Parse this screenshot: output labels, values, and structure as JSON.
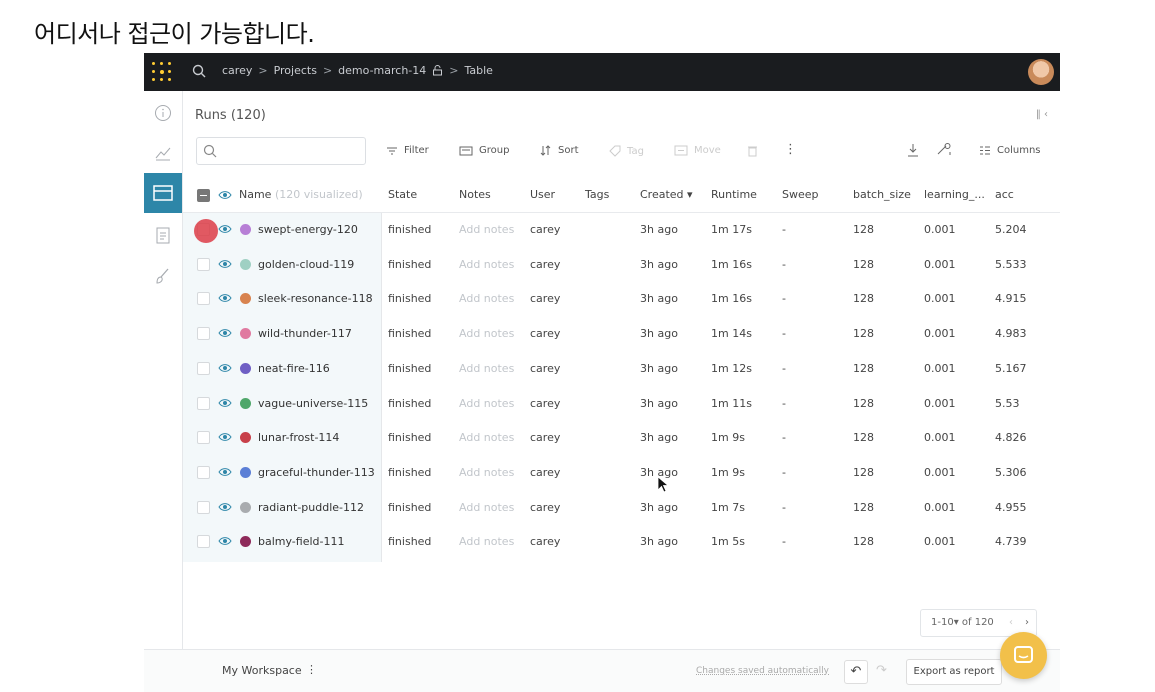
{
  "caption": "어디서나 접근이 가능합니다.",
  "topbar": {
    "breadcrumbs": [
      "carey",
      "Projects",
      "demo-march-14",
      "Table"
    ],
    "separator": ">"
  },
  "runs": {
    "title": "Runs (120)",
    "collapse_icon": "‖ ‹"
  },
  "search": {
    "placeholder": ""
  },
  "toolbar": {
    "filter": "Filter",
    "group": "Group",
    "sort": "Sort",
    "tag": "Tag",
    "move": "Move",
    "more": "⋮",
    "columns": "Columns"
  },
  "table": {
    "name_header": "Name",
    "name_header_note": "(120 visualized)",
    "columns": [
      "State",
      "Notes",
      "User",
      "Tags",
      "Created ▾",
      "Runtime",
      "Sweep",
      "batch_size",
      "learning_...",
      "acc"
    ],
    "rows": [
      {
        "name": "swept-energy-120",
        "color": "#b77fd6",
        "state": "finished",
        "notes": "Add notes",
        "user": "carey",
        "tags": "",
        "created": "3h ago",
        "runtime": "1m 17s",
        "sweep": "-",
        "batch_size": "128",
        "lr": "0.001",
        "acc": "5.204"
      },
      {
        "name": "golden-cloud-119",
        "color": "#9fd0c3",
        "state": "finished",
        "notes": "Add notes",
        "user": "carey",
        "tags": "",
        "created": "3h ago",
        "runtime": "1m 16s",
        "sweep": "-",
        "batch_size": "128",
        "lr": "0.001",
        "acc": "5.533"
      },
      {
        "name": "sleek-resonance-118",
        "color": "#d8834f",
        "state": "finished",
        "notes": "Add notes",
        "user": "carey",
        "tags": "",
        "created": "3h ago",
        "runtime": "1m 16s",
        "sweep": "-",
        "batch_size": "128",
        "lr": "0.001",
        "acc": "4.915"
      },
      {
        "name": "wild-thunder-117",
        "color": "#e07aa0",
        "state": "finished",
        "notes": "Add notes",
        "user": "carey",
        "tags": "",
        "created": "3h ago",
        "runtime": "1m 14s",
        "sweep": "-",
        "batch_size": "128",
        "lr": "0.001",
        "acc": "4.983"
      },
      {
        "name": "neat-fire-116",
        "color": "#6f5fc4",
        "state": "finished",
        "notes": "Add notes",
        "user": "carey",
        "tags": "",
        "created": "3h ago",
        "runtime": "1m 12s",
        "sweep": "-",
        "batch_size": "128",
        "lr": "0.001",
        "acc": "5.167"
      },
      {
        "name": "vague-universe-115",
        "color": "#4fa76a",
        "state": "finished",
        "notes": "Add notes",
        "user": "carey",
        "tags": "",
        "created": "3h ago",
        "runtime": "1m 11s",
        "sweep": "-",
        "batch_size": "128",
        "lr": "0.001",
        "acc": "5.53"
      },
      {
        "name": "lunar-frost-114",
        "color": "#c8404a",
        "state": "finished",
        "notes": "Add notes",
        "user": "carey",
        "tags": "",
        "created": "3h ago",
        "runtime": "1m 9s",
        "sweep": "-",
        "batch_size": "128",
        "lr": "0.001",
        "acc": "4.826"
      },
      {
        "name": "graceful-thunder-113",
        "color": "#5b7fd6",
        "state": "finished",
        "notes": "Add notes",
        "user": "carey",
        "tags": "",
        "created": "3h ago",
        "runtime": "1m 9s",
        "sweep": "-",
        "batch_size": "128",
        "lr": "0.001",
        "acc": "5.306"
      },
      {
        "name": "radiant-puddle-112",
        "color": "#a9acaf",
        "state": "finished",
        "notes": "Add notes",
        "user": "carey",
        "tags": "",
        "created": "3h ago",
        "runtime": "1m 7s",
        "sweep": "-",
        "batch_size": "128",
        "lr": "0.001",
        "acc": "4.955"
      },
      {
        "name": "balmy-field-111",
        "color": "#8e2a5a",
        "state": "finished",
        "notes": "Add notes",
        "user": "carey",
        "tags": "",
        "created": "3h ago",
        "runtime": "1m 5s",
        "sweep": "-",
        "batch_size": "128",
        "lr": "0.001",
        "acc": "4.739"
      }
    ]
  },
  "pagination": {
    "range": "1-10▾ of 120",
    "prev": "‹",
    "next": "›"
  },
  "footer": {
    "workspace": "My Workspace",
    "workspace_menu": "⋮",
    "saved": "Changes saved automatically",
    "undo": "↶",
    "redo": "↷",
    "export": "Export as report"
  },
  "colors": {
    "accent": "#2d86a8",
    "topbar": "#1a1c1f",
    "fab": "#f2c04a"
  }
}
